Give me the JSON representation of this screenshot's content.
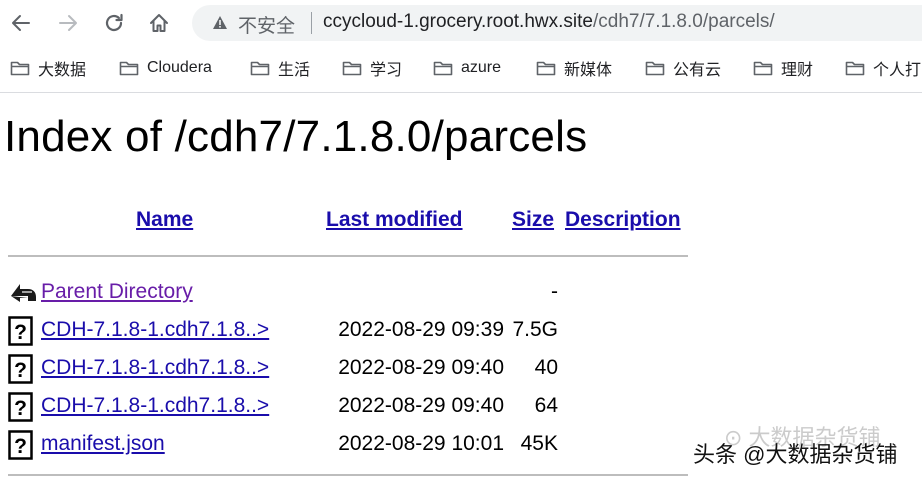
{
  "browser": {
    "security_label": "不安全",
    "url_host": "ccycloud-1.grocery.root.hwx.site",
    "url_path": "/cdh7/7.1.8.0/parcels/"
  },
  "bookmarks": [
    {
      "label": "大数据"
    },
    {
      "label": "Cloudera"
    },
    {
      "label": "生活"
    },
    {
      "label": "学习"
    },
    {
      "label": "azure"
    },
    {
      "label": "新媒体"
    },
    {
      "label": "公有云"
    },
    {
      "label": "理财"
    },
    {
      "label": "个人打"
    }
  ],
  "page": {
    "title": "Index of /cdh7/7.1.8.0/parcels",
    "columns": {
      "name": "Name",
      "modified": "Last modified",
      "size": "Size",
      "description": "Description"
    },
    "rows": [
      {
        "name": "Parent Directory",
        "date": "",
        "size": "-",
        "icon": "back-folder-icon"
      },
      {
        "name": "CDH-7.1.8-1.cdh7.1.8..>",
        "date": "2022-08-29 09:39",
        "size": "7.5G",
        "icon": "unknown-file-icon"
      },
      {
        "name": "CDH-7.1.8-1.cdh7.1.8..>",
        "date": "2022-08-29 09:40",
        "size": "40",
        "icon": "unknown-file-icon"
      },
      {
        "name": "CDH-7.1.8-1.cdh7.1.8..>",
        "date": "2022-08-29 09:40",
        "size": "64",
        "icon": "unknown-file-icon"
      },
      {
        "name": "manifest.json",
        "date": "2022-08-29 10:01",
        "size": "45K",
        "icon": "unknown-file-icon"
      }
    ]
  },
  "watermark": {
    "text": "头条 @大数据杂货铺",
    "faint_text": "大数据杂货铺"
  }
}
